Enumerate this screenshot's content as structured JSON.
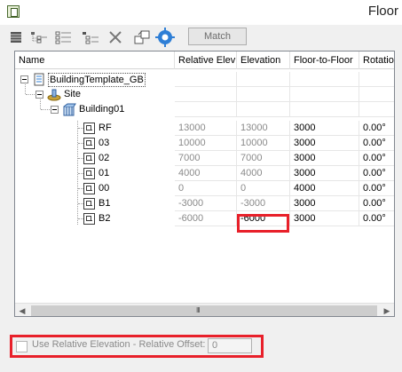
{
  "window": {
    "title": "Floor"
  },
  "toolbar": {
    "icons": [
      "list-icon",
      "tree-add-icon",
      "tree-insert-icon",
      "tree-list-icon",
      "delete-x-icon",
      "import-icon",
      "settings-gear-icon"
    ],
    "match_label": "Match"
  },
  "grid": {
    "columns": [
      "Name",
      "Relative Elev",
      "Elevation",
      "Floor-to-Floor",
      "Rotation"
    ],
    "tree": {
      "template": "BuildingTemplate_GB",
      "site": "Site",
      "building": "Building01"
    },
    "floors": [
      {
        "name": "RF",
        "relative_elev": "13000",
        "elevation": "13000",
        "floor_to_floor": "3000",
        "rotation": "0.00°"
      },
      {
        "name": "03",
        "relative_elev": "10000",
        "elevation": "10000",
        "floor_to_floor": "3000",
        "rotation": "0.00°"
      },
      {
        "name": "02",
        "relative_elev": "7000",
        "elevation": "7000",
        "floor_to_floor": "3000",
        "rotation": "0.00°"
      },
      {
        "name": "01",
        "relative_elev": "4000",
        "elevation": "4000",
        "floor_to_floor": "3000",
        "rotation": "0.00°"
      },
      {
        "name": "00",
        "relative_elev": "0",
        "elevation": "0",
        "floor_to_floor": "4000",
        "rotation": "0.00°"
      },
      {
        "name": "B1",
        "relative_elev": "-3000",
        "elevation": "-3000",
        "floor_to_floor": "3000",
        "rotation": "0.00°"
      },
      {
        "name": "B2",
        "relative_elev": "-6000",
        "elevation": "-6000",
        "floor_to_floor": "3000",
        "rotation": "0.00°"
      }
    ],
    "scroll_grip": "III"
  },
  "options": {
    "use_relative_label": "Use Relative Elevation - Relative Offset:",
    "use_relative_checked": false,
    "relative_offset_value": "0"
  },
  "colors": {
    "highlight": "#e8202a",
    "accent_blue": "#2f7fd6"
  }
}
